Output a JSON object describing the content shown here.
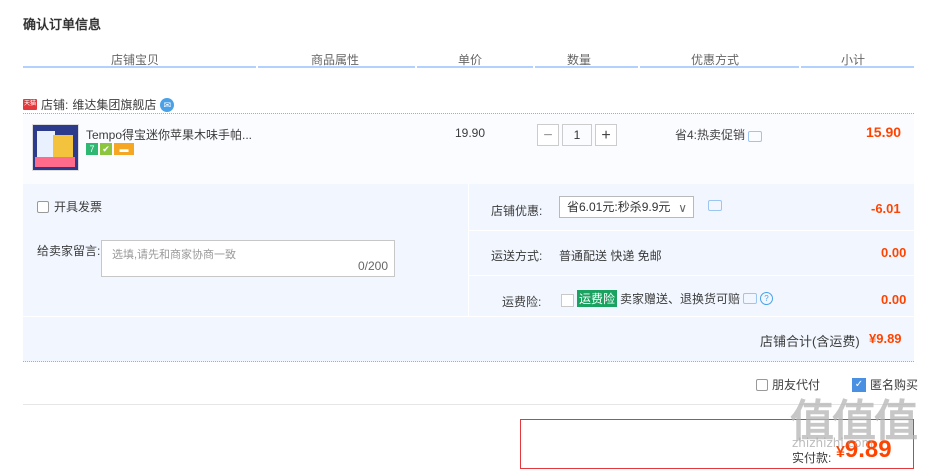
{
  "page": {
    "title": "确认订单信息"
  },
  "columns": [
    "店铺宝贝",
    "商品属性",
    "单价",
    "数量",
    "优惠方式",
    "小计"
  ],
  "shop": {
    "label": "店铺:",
    "name": "维达集团旗舰店",
    "mall_badge": "天猫"
  },
  "item": {
    "name": "Tempo得宝迷你苹果木味手帕...",
    "badges": [
      {
        "text": "7",
        "color": "#2eb872"
      },
      {
        "text": "✔",
        "color": "#8cc63f"
      },
      {
        "text": "▬",
        "color": "#f5a623"
      }
    ],
    "price": "19.90",
    "quantity": "1",
    "minus": "−",
    "plus": "+",
    "promo": "省4:热卖促销",
    "subtotal": "15.90"
  },
  "options": {
    "invoice_label": "开具发票",
    "message_label": "给卖家留言:",
    "message_placeholder": "选填,请先和商家协商一致",
    "message_count": "0/200",
    "shop_discount_label": "店铺优惠:",
    "shop_discount_value": "省6.01元:秒杀9.9元",
    "shop_discount_amount": "-6.01",
    "shipping_label": "运送方式:",
    "shipping_value": "普通配送 快递 免邮",
    "shipping_amount": "0.00",
    "insurance_label": "运费险:",
    "insurance_tag": "运费险",
    "insurance_text": "卖家赠送、退换货可赔",
    "insurance_amount": "0.00",
    "shop_total_label": "店铺合计(含运费)",
    "shop_total_value": "¥9.89"
  },
  "extras": {
    "friend_pay": "朋友代付",
    "anonymous": "匿名购买"
  },
  "payment": {
    "label": "实付款:",
    "currency": "¥",
    "amount": "9.89"
  },
  "watermark": {
    "logo": "值值值",
    "url": "zhizhizhi.com"
  },
  "colors": {
    "accent": "#f40",
    "line": "#b2d1ff",
    "panel": "#f2f7ff"
  }
}
